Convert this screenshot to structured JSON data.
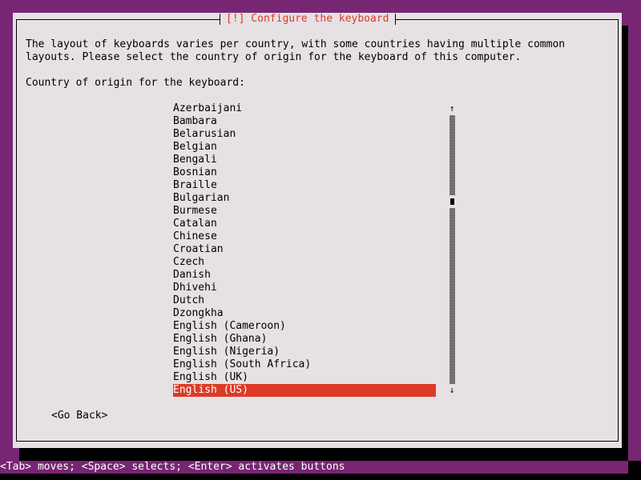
{
  "dialog": {
    "title": "[!] Configure the keyboard",
    "description_lines": [
      "The layout of keyboards varies per country, with some countries having multiple common",
      "layouts. Please select the country of origin for the keyboard of this computer."
    ],
    "prompt": "Country of origin for the keyboard:",
    "list": {
      "items": [
        "Azerbaijani",
        "Bambara",
        "Belarusian",
        "Belgian",
        "Bengali",
        "Bosnian",
        "Braille",
        "Bulgarian",
        "Burmese",
        "Catalan",
        "Chinese",
        "Croatian",
        "Czech",
        "Danish",
        "Dhivehi",
        "Dutch",
        "Dzongkha",
        "English (Cameroon)",
        "English (Ghana)",
        "English (Nigeria)",
        "English (South Africa)",
        "English (UK)",
        "English (US)"
      ],
      "selected": "English (US)",
      "scroll_up_glyph": "↑",
      "scroll_down_glyph": "↓"
    },
    "go_back_label": "<Go Back>"
  },
  "status_bar": {
    "text": "<Tab> moves; <Space> selects; <Enter> activates buttons"
  },
  "colors": {
    "background": "#772673",
    "dialog": "#e6e1e5",
    "accent": "#dc3a26",
    "selected_text": "#ffffff"
  }
}
